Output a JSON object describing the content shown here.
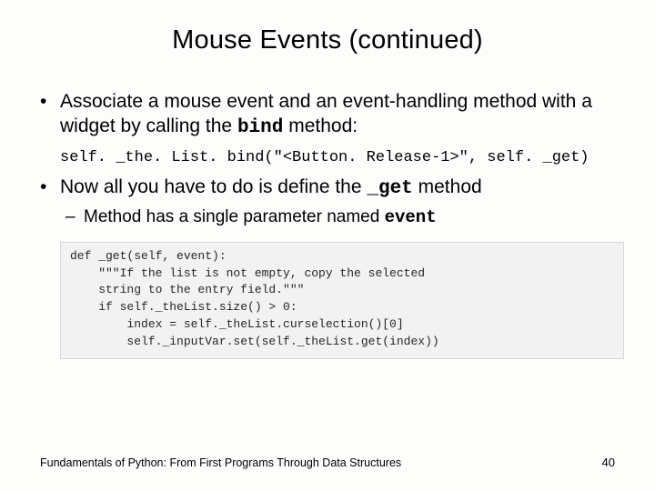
{
  "title": "Mouse Events (continued)",
  "bullet1_pre": "Associate a mouse event and an event-handling method with a widget by calling the ",
  "bullet1_code": "bind",
  "bullet1_post": " method:",
  "snippet1": "self. _the. List. bind(\"<Button. Release-1>\", self. _get)",
  "bullet2_pre": "Now all you have to do is define the ",
  "bullet2_code": "_get",
  "bullet2_post": " method",
  "sub1_pre": "Method has a single parameter named ",
  "sub1_code": "event",
  "code_block": "def _get(self, event):\n    \"\"\"If the list is not empty, copy the selected\n    string to the entry field.\"\"\"\n    if self._theList.size() > 0:\n        index = self._theList.curselection()[0]\n        self._inputVar.set(self._theList.get(index))",
  "footer_text": "Fundamentals of Python: From First Programs Through Data Structures",
  "page_number": "40"
}
